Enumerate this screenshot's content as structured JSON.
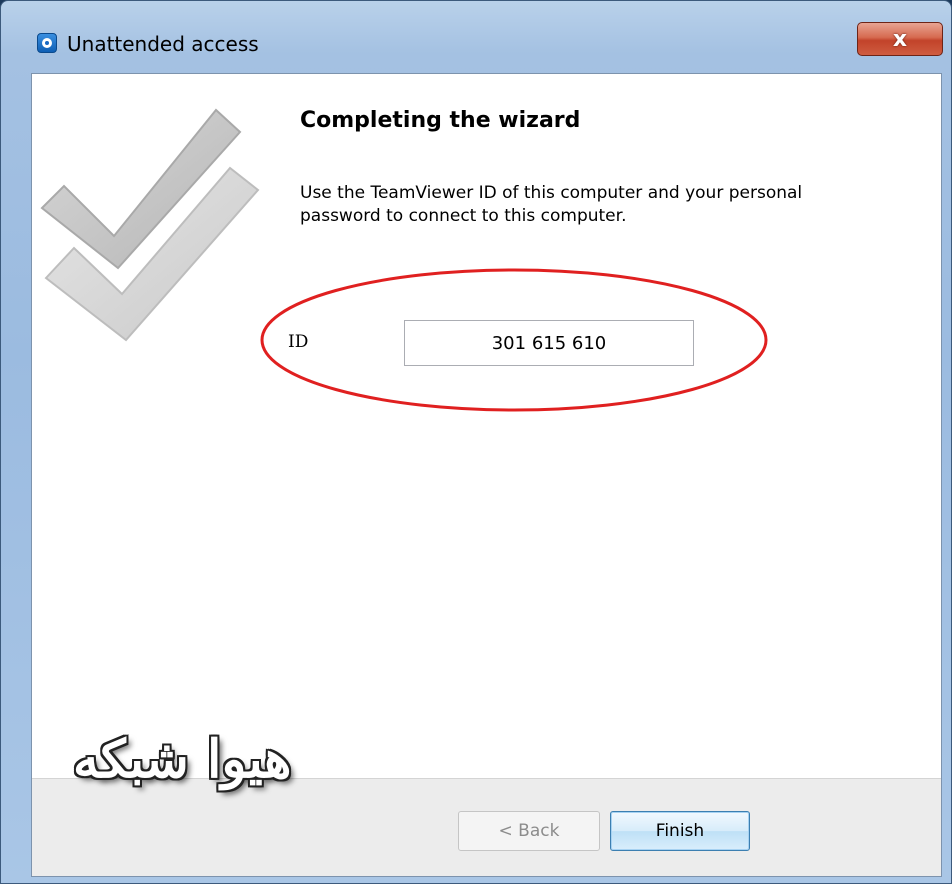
{
  "window": {
    "title": "Unattended access",
    "close_label": "x"
  },
  "wizard": {
    "heading": "Completing the wizard",
    "description": "Use the TeamViewer ID of this computer and your personal password to connect to this computer."
  },
  "id_section": {
    "label": "ID",
    "value": "301 615 610"
  },
  "footer": {
    "back_label": "< Back",
    "finish_label": "Finish"
  },
  "watermark": {
    "text": "هیوا شبکه"
  },
  "colors": {
    "highlight_ellipse": "#e02020",
    "title_bar": "#a4c1e2",
    "close_button": "#c2432a"
  }
}
